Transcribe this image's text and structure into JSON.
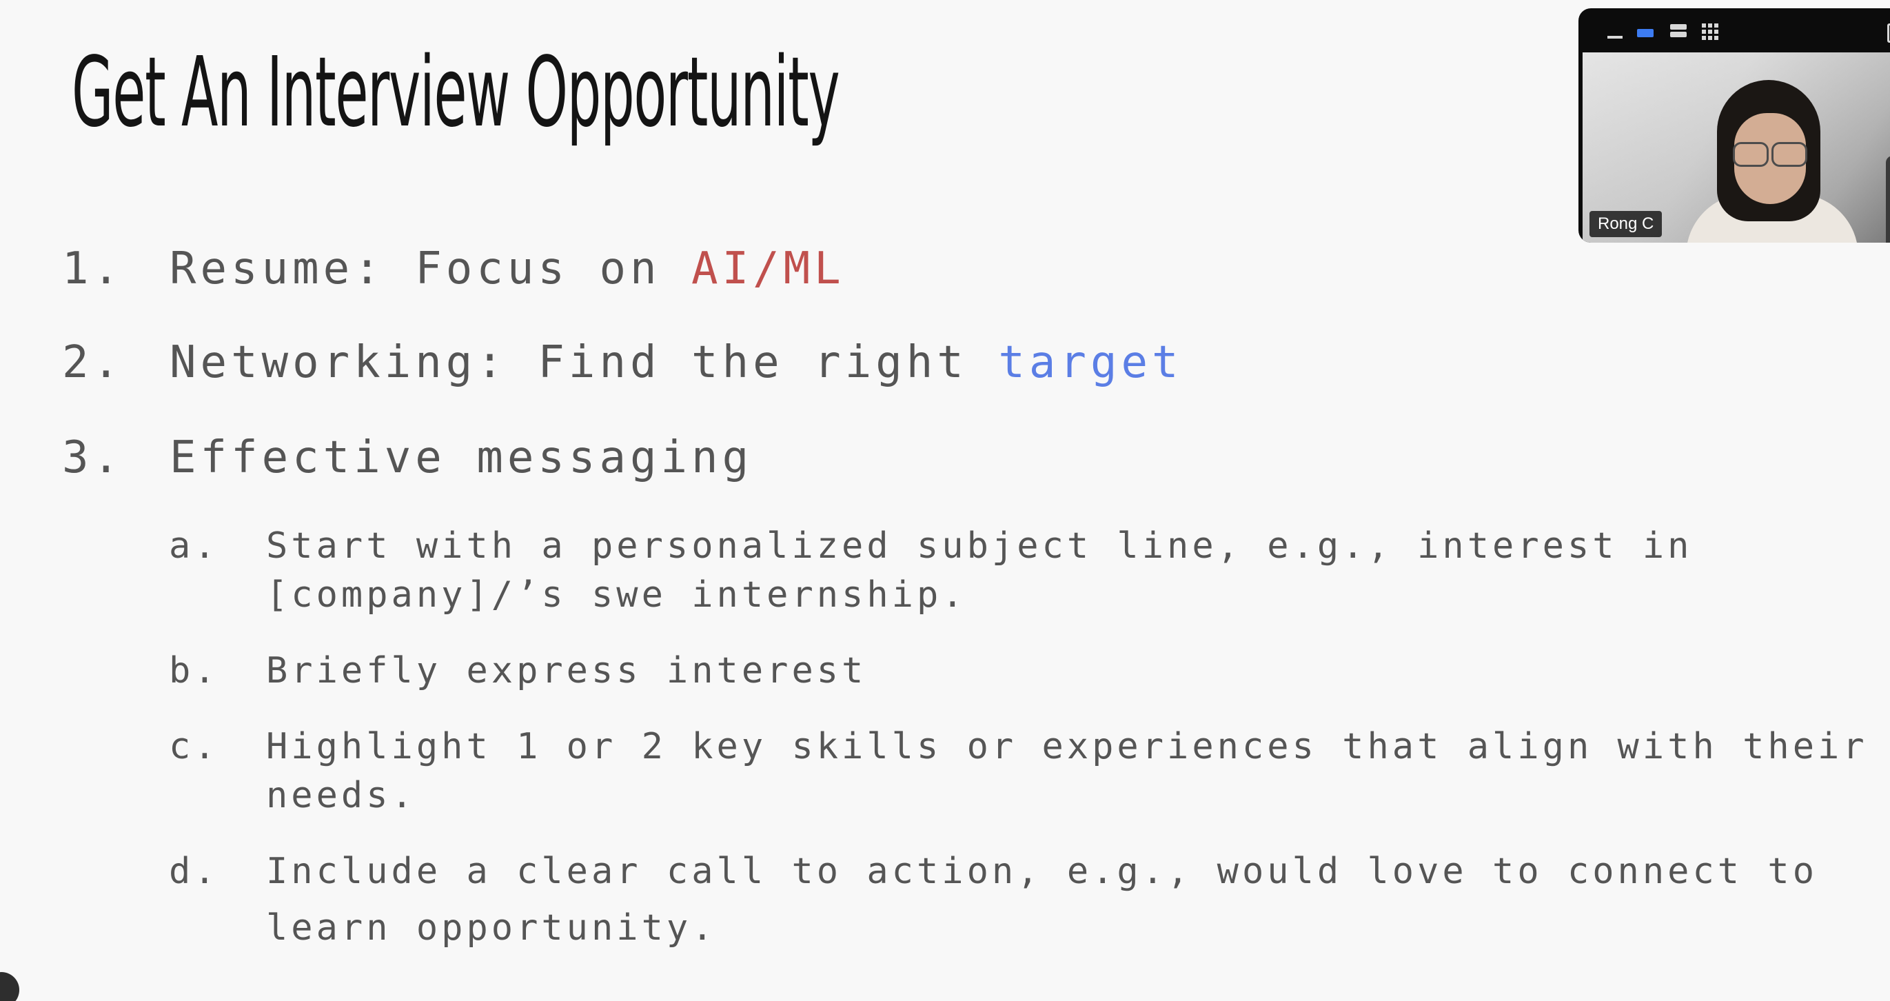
{
  "slide": {
    "title": "Get An Interview Opportunity",
    "items": [
      {
        "number": "1.",
        "prefix": "Resume: Focus on ",
        "highlight": "AI/ML",
        "highlight_color": "#c0504d"
      },
      {
        "number": "2.",
        "prefix": "Networking: Find the right ",
        "highlight": "target",
        "highlight_color": "#5b7ee5"
      },
      {
        "number": "3.",
        "text": "Effective messaging"
      }
    ],
    "subitems": [
      {
        "letter": "a.",
        "lines": [
          "Start with a personalized subject line, e.g., interest in",
          "[company]/’s swe internship."
        ]
      },
      {
        "letter": "b.",
        "lines": [
          "Briefly express interest"
        ]
      },
      {
        "letter": "c.",
        "lines": [
          "Highlight 1 or 2 key skills or experiences that align with their",
          "needs."
        ]
      },
      {
        "letter": "d.",
        "lines": [
          "Include a clear call to action, e.g., would love to connect to",
          "learn opportunity."
        ]
      }
    ]
  },
  "video_panel": {
    "participant_name": "Rong C",
    "toolbar": {
      "minimize_icon": "minimize-icon",
      "speaker_view_icon": "speaker-view-icon",
      "strip_view_icon": "strip-view-icon",
      "grid_view_icon": "grid-view-icon",
      "extra_icon": "picture-in-picture-icon"
    },
    "accent_color": "#3d7cf2"
  }
}
